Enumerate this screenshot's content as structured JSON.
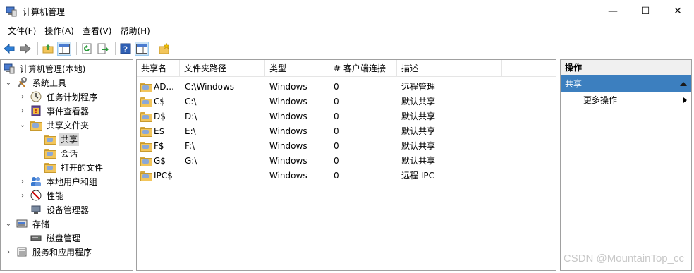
{
  "window": {
    "title": "计算机管理",
    "minimize": "—",
    "maximize": "☐",
    "close": "✕"
  },
  "menu": [
    "文件(F)",
    "操作(A)",
    "查看(V)",
    "帮助(H)"
  ],
  "toolbar": {
    "buttons": [
      "back-icon",
      "forward-icon",
      "up-folder-icon",
      "show-hide-tree-icon",
      "refresh-icon",
      "export-icon",
      "help-icon",
      "show-hide-action-icon",
      "new-share-icon"
    ]
  },
  "tree": {
    "items": [
      {
        "label": "计算机管理(本地)",
        "icon": "computer-management-icon",
        "chev": ""
      },
      {
        "label": "系统工具",
        "icon": "tools-icon",
        "chev": "⌄"
      },
      {
        "label": "任务计划程序",
        "icon": "clock-icon",
        "chev": "›"
      },
      {
        "label": "事件查看器",
        "icon": "event-viewer-icon",
        "chev": "›"
      },
      {
        "label": "共享文件夹",
        "icon": "shared-folder-icon",
        "chev": "⌄"
      },
      {
        "label": "共享",
        "icon": "share-icon",
        "chev": ""
      },
      {
        "label": "会话",
        "icon": "session-icon",
        "chev": ""
      },
      {
        "label": "打开的文件",
        "icon": "open-files-icon",
        "chev": ""
      },
      {
        "label": "本地用户和组",
        "icon": "users-icon",
        "chev": "›"
      },
      {
        "label": "性能",
        "icon": "performance-icon",
        "chev": "›"
      },
      {
        "label": "设备管理器",
        "icon": "device-manager-icon",
        "chev": ""
      },
      {
        "label": "存储",
        "icon": "storage-icon",
        "chev": "⌄"
      },
      {
        "label": "磁盘管理",
        "icon": "disk-icon",
        "chev": ""
      },
      {
        "label": "服务和应用程序",
        "icon": "services-icon",
        "chev": "›"
      }
    ]
  },
  "list": {
    "columns": [
      "共享名",
      "文件夹路径",
      "类型",
      "# 客户端连接",
      "描述"
    ],
    "rows": [
      {
        "name": "AD...",
        "path": "C:\\Windows",
        "type": "Windows",
        "clients": "0",
        "desc": "远程管理"
      },
      {
        "name": "C$",
        "path": "C:\\",
        "type": "Windows",
        "clients": "0",
        "desc": "默认共享"
      },
      {
        "name": "D$",
        "path": "D:\\",
        "type": "Windows",
        "clients": "0",
        "desc": "默认共享"
      },
      {
        "name": "E$",
        "path": "E:\\",
        "type": "Windows",
        "clients": "0",
        "desc": "默认共享"
      },
      {
        "name": "F$",
        "path": "F:\\",
        "type": "Windows",
        "clients": "0",
        "desc": "默认共享"
      },
      {
        "name": "G$",
        "path": "G:\\",
        "type": "Windows",
        "clients": "0",
        "desc": "默认共享"
      },
      {
        "name": "IPC$",
        "path": "",
        "type": "Windows",
        "clients": "0",
        "desc": "远程 IPC"
      }
    ]
  },
  "actions": {
    "title": "操作",
    "section": "共享",
    "more": "更多操作"
  },
  "watermark": "CSDN @MountainTop_cc",
  "colors": {
    "section_bg": "#3c7fbf",
    "selected_bg": "#d9d9d9"
  }
}
